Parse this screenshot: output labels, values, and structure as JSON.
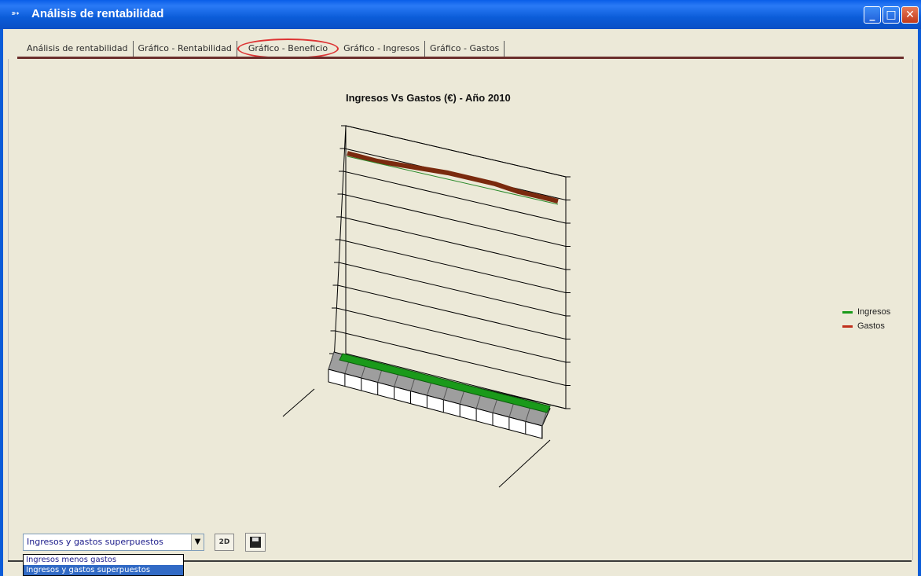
{
  "window": {
    "title": "Análisis de rentabilidad",
    "app_icon": "app-icon",
    "controls": {
      "minimize": "_",
      "maximize": "□",
      "close": "✕"
    }
  },
  "tabs": [
    {
      "label": "Análisis de rentabilidad",
      "active": false
    },
    {
      "label": "Gráfico - Rentabilidad",
      "active": false
    },
    {
      "label": "Gráfico - Beneficio",
      "active": true
    },
    {
      "label": "Gráfico - Ingresos",
      "active": false
    },
    {
      "label": "Gráfico - Gastos",
      "active": false
    }
  ],
  "chart": {
    "title": "Ingresos Vs Gastos (€) - Año 2010",
    "legend": [
      {
        "name": "Ingresos",
        "color": "#1a9a1a"
      },
      {
        "name": "Gastos",
        "color": "#c0301c"
      }
    ]
  },
  "chart_data": {
    "type": "line",
    "title": "Ingresos Vs Gastos (€) - Año 2010",
    "view": "3d",
    "series": [
      {
        "name": "Ingresos",
        "color": "#1a9a1a"
      },
      {
        "name": "Gastos",
        "color": "#c0301c"
      }
    ],
    "legend": "right"
  },
  "controls": {
    "view_select_value": "Ingresos y gastos superpuestos",
    "view_select_arrow": "▼",
    "btn_3d_label": "2D",
    "save_icon": "floppy-disk-icon",
    "dropdown_options": [
      {
        "label": "Ingresos menos gastos",
        "selected": false
      },
      {
        "label": "Ingresos y gastos superpuestos",
        "selected": true
      }
    ]
  }
}
